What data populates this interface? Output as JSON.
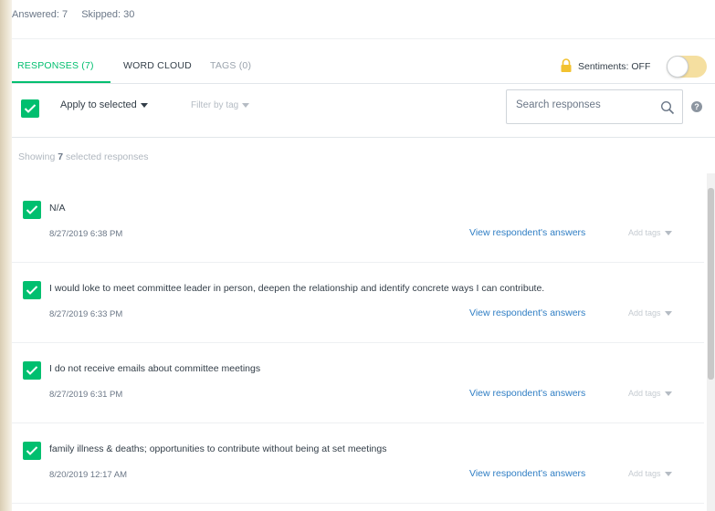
{
  "stats": {
    "answered": "Answered: 7",
    "skipped": "Skipped: 30"
  },
  "tabs": [
    {
      "label": "RESPONSES (7)",
      "active": true
    },
    {
      "label": "WORD CLOUD",
      "active": false
    },
    {
      "label": "TAGS (0)",
      "active": false
    }
  ],
  "sentiments": {
    "label": "Sentiments: OFF",
    "state": "off"
  },
  "toolbar": {
    "apply_label": "Apply to selected",
    "filter_label": "Filter by tag",
    "search_placeholder": "Search responses",
    "help": "?"
  },
  "summary": {
    "prefix": "Showing",
    "count": "7",
    "suffix": "selected responses"
  },
  "responses": [
    {
      "text": "N/A",
      "date": "8/27/2019 6:38 PM"
    },
    {
      "text": "I would loke to meet committee leader in person, deepen the relationship and identify concrete ways I can contribute.",
      "date": "8/27/2019 6:33 PM"
    },
    {
      "text": "I do not receive emails about committee meetings",
      "date": "8/27/2019 6:31 PM"
    },
    {
      "text": "family illness & deaths; opportunities to contribute without being at set meetings",
      "date": "8/20/2019 12:17 AM"
    }
  ],
  "view_answers_label": "View respondent's answers",
  "add_tags_label": "Add tags",
  "colors": {
    "accent": "#00bf6f",
    "link": "#2f7ec4",
    "toggle_off": "#f5dfa0",
    "lock": "#f2c230"
  },
  "icons": [
    "lock-icon",
    "checkmark-icon",
    "caret-down-icon",
    "search-icon",
    "help-icon"
  ]
}
